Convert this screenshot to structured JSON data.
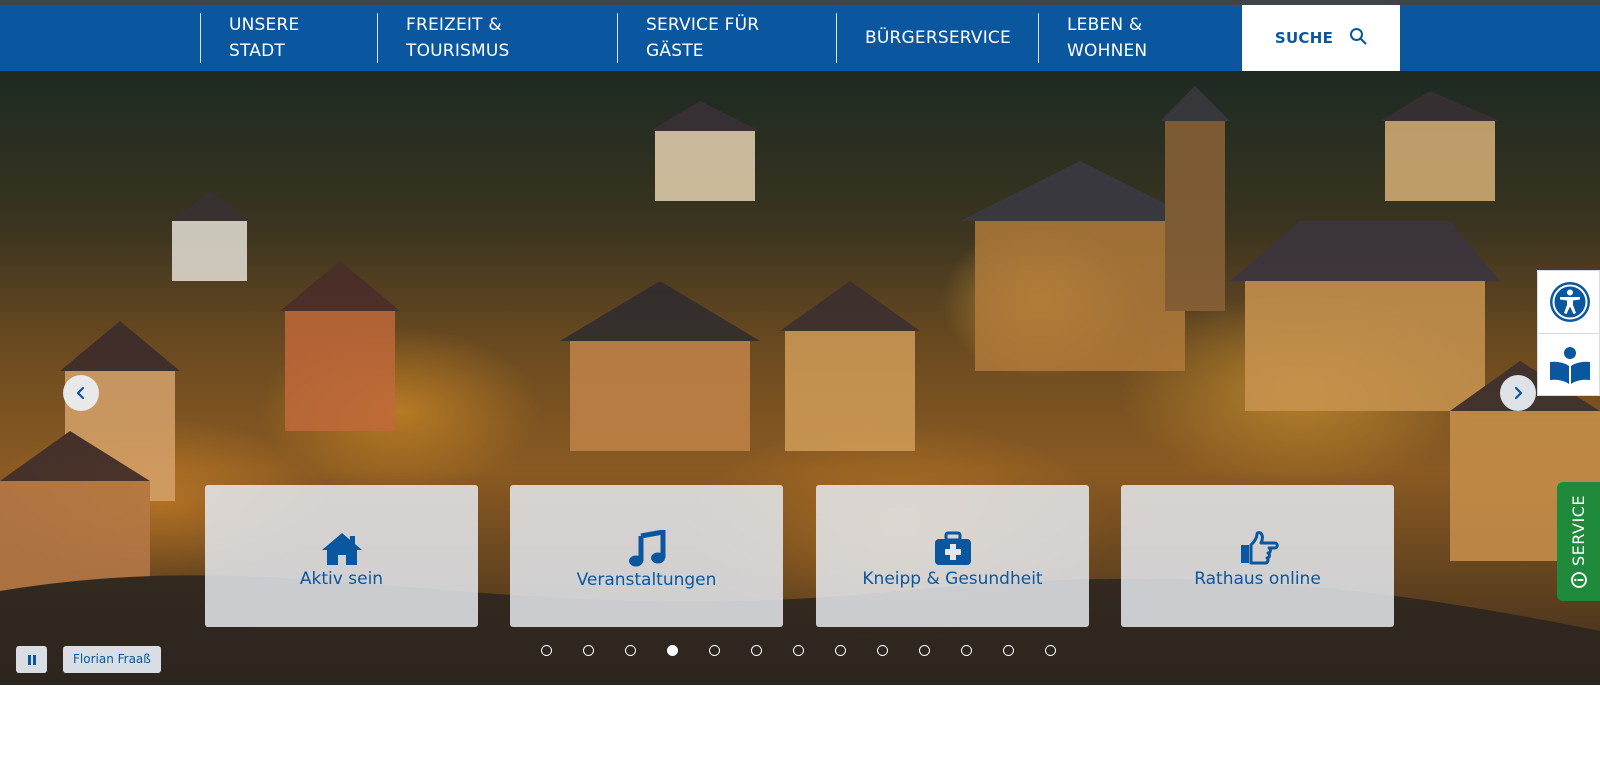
{
  "nav": {
    "items": [
      {
        "line1": "UNSERE",
        "line2": "STADT"
      },
      {
        "line1": "FREIZEIT &",
        "line2": "TOURISMUS"
      },
      {
        "line1": "SERVICE FÜR",
        "line2": "GÄSTE"
      },
      {
        "line1": "BÜRGERSERVICE",
        "line2": ""
      },
      {
        "line1": "LEBEN &",
        "line2": "WOHNEN"
      }
    ],
    "search_label": "SUCHE"
  },
  "hero": {
    "tiles": [
      {
        "label": "Aktiv sein",
        "icon": "home-icon"
      },
      {
        "label": "Veranstaltungen",
        "icon": "music-note-icon"
      },
      {
        "label": "Kneipp & Gesundheit",
        "icon": "first-aid-kit-icon"
      },
      {
        "label": "Rathaus online",
        "icon": "pointing-hand-icon"
      }
    ],
    "slides_count": 13,
    "active_slide": 4,
    "photo_credit": "Florian Fraaß"
  },
  "side": {
    "service_label": "SERVICE",
    "accessibility_icon": "accessibility-icon",
    "easy_language_icon": "reading-person-icon"
  },
  "colors": {
    "brand_blue": "#0a57a0",
    "service_green": "#1f8a3c"
  }
}
